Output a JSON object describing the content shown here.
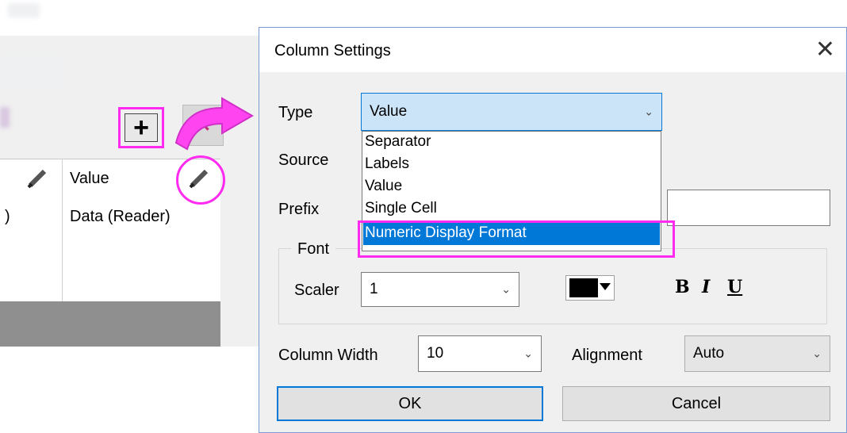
{
  "background": {
    "column_header": "Value",
    "cell_value": "Data (Reader)",
    "cell_left_fragment": ")"
  },
  "dialog": {
    "title": "Column Settings",
    "close_glyph": "✕",
    "type_label": "Type",
    "type_value": "Value",
    "source_label": "Source",
    "prefix_label": "Prefix",
    "type_options": [
      "Separator",
      "Labels",
      "Value",
      "Single Cell",
      "Numeric Display Format"
    ],
    "font_group_label": "Font",
    "scaler_label": "Scaler",
    "scaler_value": "1",
    "bold_label": "B",
    "italic_label": "I",
    "underline_label": "U",
    "column_width_label": "Column Width",
    "column_width_value": "10",
    "alignment_label": "Alignment",
    "alignment_value": "Auto",
    "ok_label": "OK",
    "cancel_label": "Cancel"
  },
  "toolbar": {
    "add_glyph": "+",
    "delete_glyph": "✕"
  },
  "colors": {
    "highlight": "#ff2bf0",
    "selection": "#0078d7",
    "font_color": "#000000"
  },
  "icons": [
    "plus-icon",
    "delete-icon",
    "pencil-icon",
    "chevron-down-icon",
    "curved-arrow-icon",
    "close-icon"
  ]
}
